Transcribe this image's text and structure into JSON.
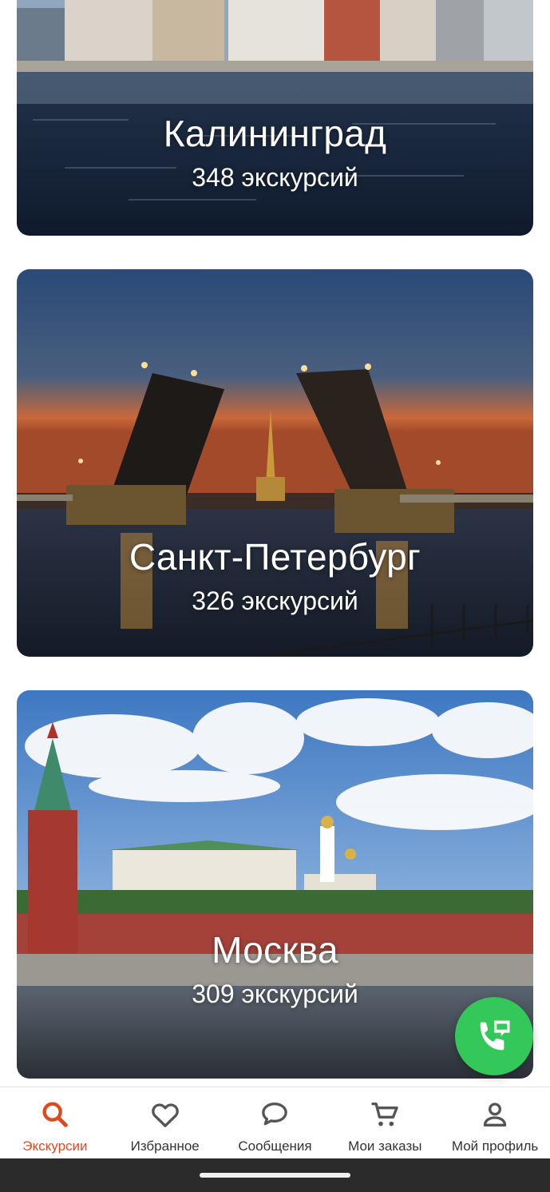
{
  "cards": [
    {
      "city": "Калининград",
      "count": "348 экскурсий"
    },
    {
      "city": "Санкт-Петербург",
      "count": "326 экскурсий"
    },
    {
      "city": "Москва",
      "count": "309 экскурсий"
    }
  ],
  "fab": {
    "icon": "phone-chat-icon",
    "color": "#34c759"
  },
  "nav": {
    "items": [
      {
        "label": "Экскурсии",
        "icon": "search-icon",
        "active": true
      },
      {
        "label": "Избранное",
        "icon": "heart-icon",
        "active": false
      },
      {
        "label": "Сообщения",
        "icon": "chat-bubble-icon",
        "active": false
      },
      {
        "label": "Мои заказы",
        "icon": "cart-icon",
        "active": false
      },
      {
        "label": "Мой профиль",
        "icon": "person-icon",
        "active": false
      }
    ],
    "active_color": "#e0491d",
    "inactive_color": "#555555"
  }
}
